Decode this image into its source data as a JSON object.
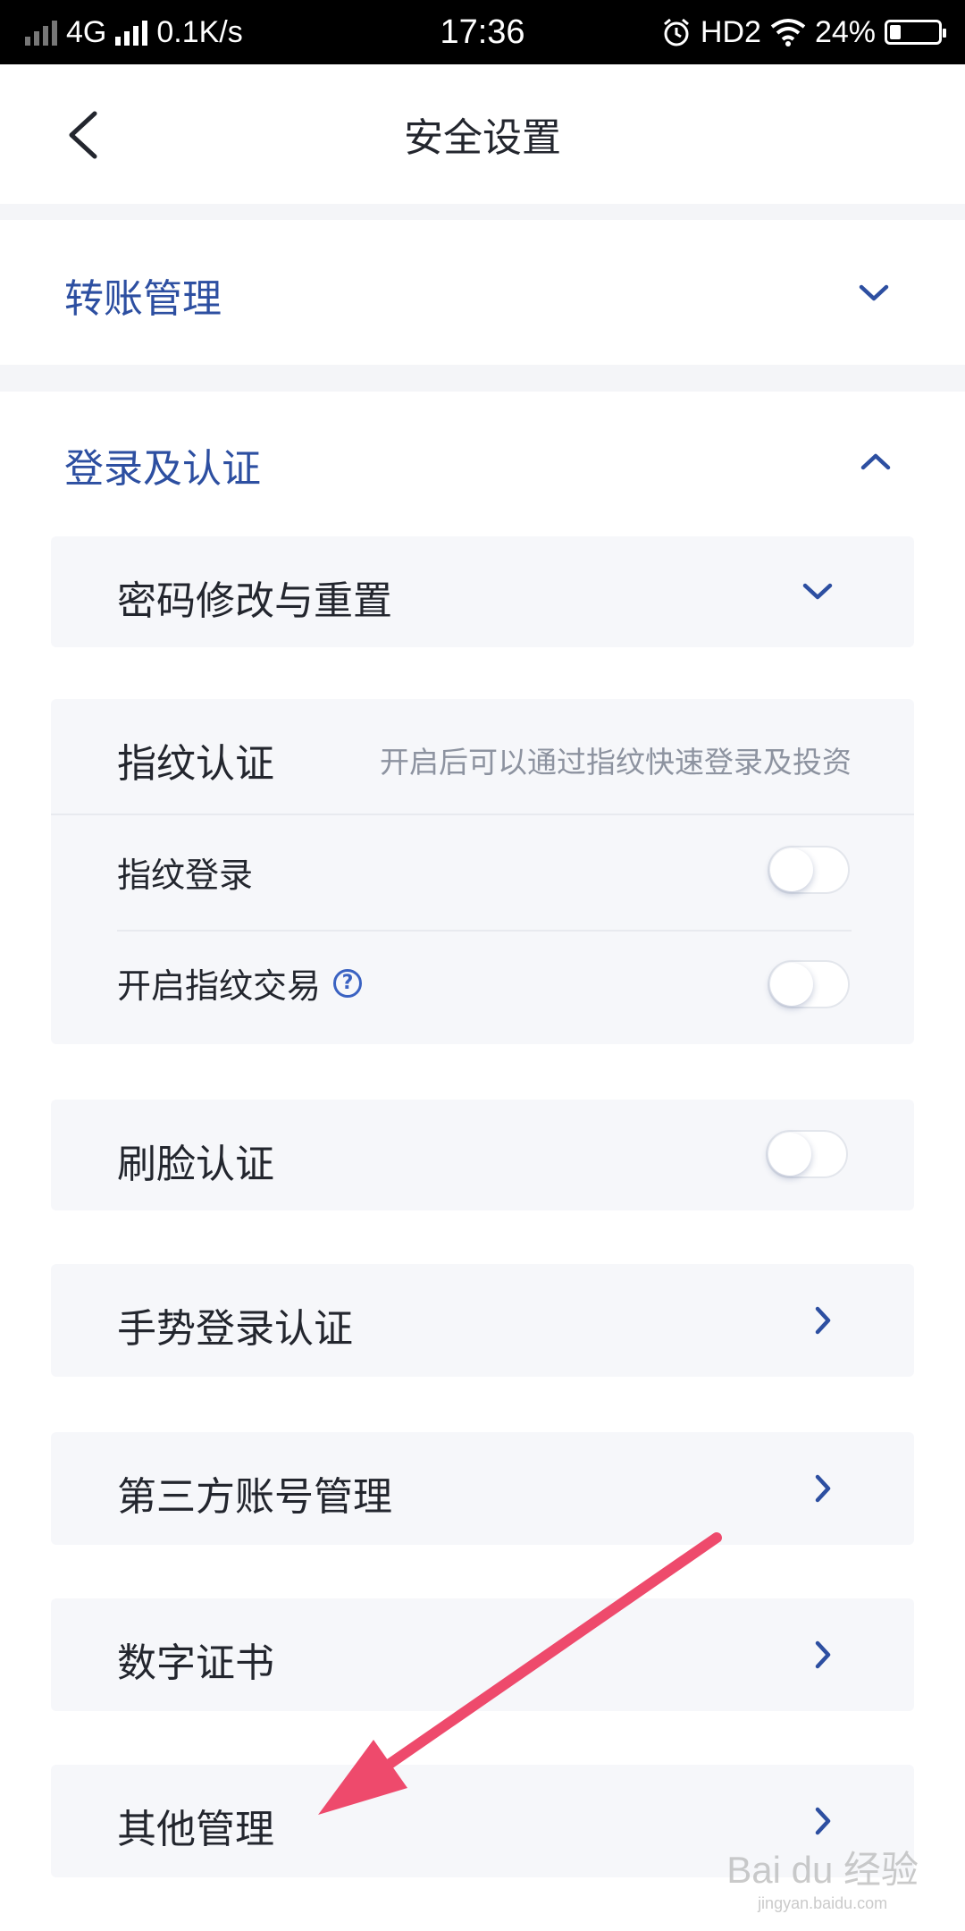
{
  "status_bar": {
    "network": "4G",
    "speed": "0.1K/s",
    "time": "17:36",
    "hd": "HD2",
    "battery": "24%"
  },
  "nav": {
    "title": "安全设置"
  },
  "sections": {
    "transfer": {
      "title": "转账管理"
    },
    "login": {
      "title": "登录及认证"
    }
  },
  "items": {
    "password": {
      "label": "密码修改与重置"
    },
    "fingerprint": {
      "title": "指纹认证",
      "hint": "开启后可以通过指纹快速登录及投资",
      "login_label": "指纹登录",
      "trade_label": "开启指纹交易",
      "help_glyph": "?"
    },
    "face": {
      "label": "刷脸认证"
    },
    "gesture": {
      "label": "手势登录认证"
    },
    "third_party": {
      "label": "第三方账号管理"
    },
    "certificate": {
      "label": "数字证书"
    },
    "other": {
      "label": "其他管理"
    }
  },
  "toggles": {
    "fingerprint_login": false,
    "fingerprint_trade": false,
    "face": false
  },
  "watermark": {
    "logo": "Bai du 经验",
    "url": "jingyan.baidu.com"
  },
  "colors": {
    "accent": "#2d4fa1",
    "annotation_arrow": "#ee4a6c",
    "card_bg": "#f6f7fa"
  }
}
